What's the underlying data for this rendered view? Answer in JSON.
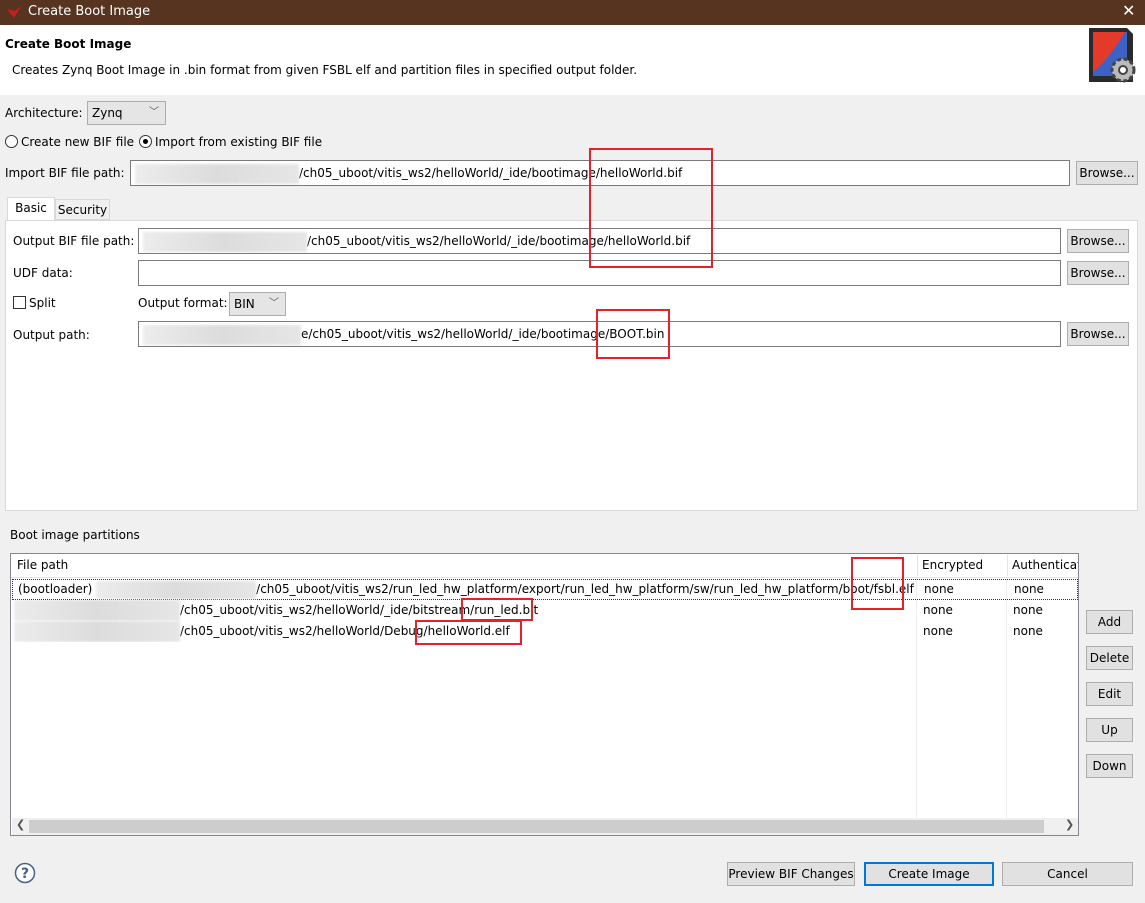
{
  "window": {
    "title": "Create Boot Image",
    "close_icon": "close-icon"
  },
  "header": {
    "title": "Create Boot Image",
    "description": "Creates Zynq Boot Image in .bin format from given FSBL elf and partition files in specified output folder."
  },
  "architecture": {
    "label": "Architecture:",
    "value": "Zynq"
  },
  "bif_mode": {
    "create_label": "Create new BIF file",
    "import_label": "Import from existing BIF file",
    "selected": "import"
  },
  "import_bif": {
    "label": "Import BIF file path:",
    "value": "/ch05_uboot/vitis_ws2/helloWorld/_ide/bootimage/helloWorld.bif",
    "browse": "Browse..."
  },
  "tabs": [
    {
      "label": "Basic",
      "active": true
    },
    {
      "label": "Security",
      "active": false
    }
  ],
  "basic": {
    "output_bif": {
      "label": "Output BIF file path:",
      "value": "/ch05_uboot/vitis_ws2/helloWorld/_ide/bootimage/helloWorld.bif",
      "browse": "Browse..."
    },
    "udf": {
      "label": "UDF data:",
      "value": "",
      "browse": "Browse..."
    },
    "split": {
      "label": "Split",
      "checked": false
    },
    "output_format": {
      "label": "Output format:",
      "value": "BIN"
    },
    "output_path": {
      "label": "Output path:",
      "value": "e/ch05_uboot/vitis_ws2/helloWorld/_ide/bootimage/BOOT.bin",
      "browse": "Browse..."
    }
  },
  "partitions": {
    "label": "Boot image partitions",
    "columns": [
      "File path",
      "Encrypted",
      "Authenticat"
    ],
    "rows": [
      {
        "path_prefix": "(bootloader) ",
        "path": "/ch05_uboot/vitis_ws2/run_led_hw_platform/export/run_led_hw_platform/sw/run_led_hw_platform/boot/fsbl.elf",
        "encrypted": "none",
        "auth": "none"
      },
      {
        "path_prefix": "",
        "path": "/ch05_uboot/vitis_ws2/helloWorld/_ide/bitstream/run_led.bit",
        "encrypted": "none",
        "auth": "none"
      },
      {
        "path_prefix": "",
        "path": "/ch05_uboot/vitis_ws2/helloWorld/Debug/helloWorld.elf",
        "encrypted": "none",
        "auth": "none"
      }
    ],
    "buttons": {
      "add": "Add",
      "delete": "Delete",
      "edit": "Edit",
      "up": "Up",
      "down": "Down"
    }
  },
  "footer": {
    "help_icon": "help-icon",
    "preview": "Preview BIF Changes",
    "create": "Create Image",
    "cancel": "Cancel"
  },
  "colors": {
    "titlebar": "#56341f",
    "annotation": "#e8202a",
    "default_button_border": "#0078d7"
  }
}
